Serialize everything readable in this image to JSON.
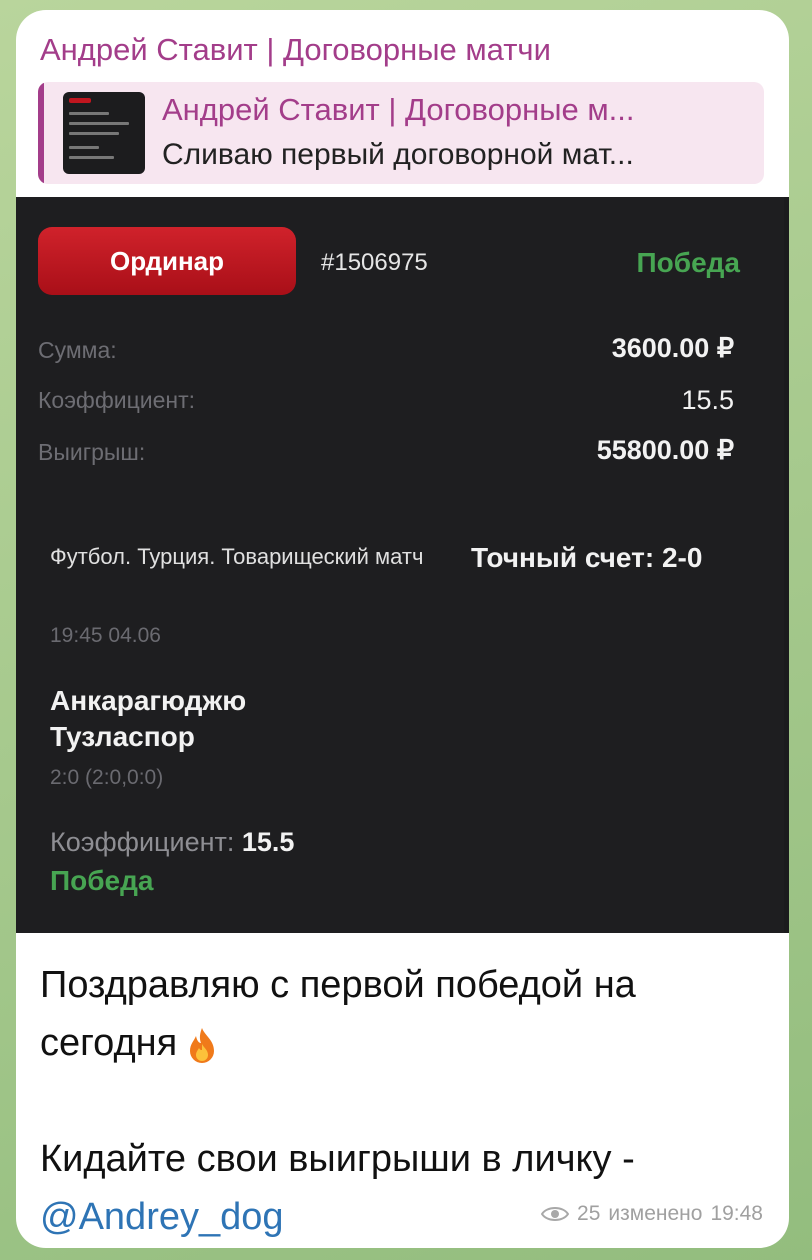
{
  "channel": {
    "name": "Андрей Ставит | Договорные матчи"
  },
  "reply": {
    "title": "Андрей Ставит | Договорные м...",
    "text": "Сливаю первый договорной мат..."
  },
  "bet_card": {
    "type_label": "Ординар",
    "bet_id": "#1506975",
    "result": "Победа",
    "rows": [
      {
        "label": "Сумма:",
        "value": "3600.00 ₽"
      },
      {
        "label": "Коэффициент:",
        "value": "15.5"
      },
      {
        "label": "Выигрыш:",
        "value": "55800.00 ₽"
      }
    ],
    "event": "Футбол. Турция. Товарищеский матч",
    "outcome": "Точный счет: 2-0",
    "time": "19:45 04.06",
    "team_home": "Анкарагюджю",
    "team_away": "Тузласпор",
    "score": "2:0 (2:0,0:0)",
    "coef_label": "Коэффициент:",
    "coef_value": "15.5",
    "result_bottom": "Победа",
    "colors": {
      "accent_red": "#c0161f",
      "win_green": "#47a552",
      "card_bg": "#1e1e20"
    }
  },
  "message": {
    "line1": "Поздравляю с первой победой на сегодня",
    "line2_prefix": "Кидайте свои выигрыши в личку - ",
    "mention": "@Andrey_dog"
  },
  "meta": {
    "views": "25",
    "status": "изменено",
    "time": "19:48"
  },
  "colors": {
    "sender": "#a33d8a",
    "link": "#2e74b5",
    "chat_bg": "#a9c98f"
  }
}
